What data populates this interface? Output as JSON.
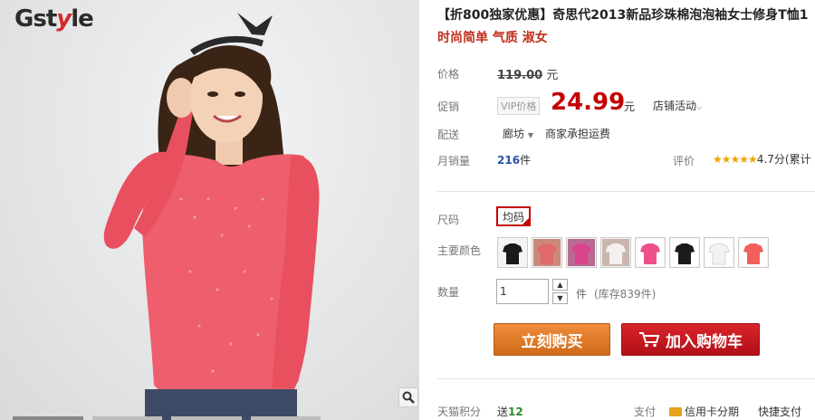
{
  "gallery": {
    "brand_prefix": "Gst",
    "brand_y": "y",
    "brand_suffix": "le"
  },
  "product": {
    "title": "【折800独家优惠】奇思代2013新品珍珠棉泡泡袖女士修身T恤1",
    "subtitle": "时尚简单 气质 淑女"
  },
  "price": {
    "label": "价格",
    "original": "119.00",
    "unit": "元"
  },
  "promo": {
    "label": "促销",
    "vip_tag": "VIP价格",
    "price": "24.99",
    "unit": "元",
    "shop_event": "店铺活动"
  },
  "shipping": {
    "label": "配送",
    "city": "廊坊",
    "note": "商家承担运费"
  },
  "sales": {
    "label": "月销量",
    "count": "216",
    "unit": "件"
  },
  "rating": {
    "label": "评价",
    "stars": "★★★★★",
    "text": "4.7分(累计"
  },
  "size": {
    "label": "尺码",
    "selected": "均码"
  },
  "color": {
    "label": "主要颜色",
    "swatches": [
      "#1a1a1a",
      "#e06a6a",
      "#d9448c",
      "#f4f0ee",
      "#ef4f8a",
      "#1b1b1b",
      "#fafafa",
      "#f2605e"
    ]
  },
  "quantity": {
    "label": "数量",
    "value": "1",
    "unit": "件",
    "stock": "(库存839件)"
  },
  "actions": {
    "buy_now": "立刻购买",
    "add_to_cart": "加入购物车"
  },
  "footer": {
    "points_label": "天猫积分",
    "points_prefix": "送",
    "points_value": "12",
    "pay_label": "支付",
    "card_pay": "信用卡分期",
    "quick_pay": "快捷支付"
  },
  "colors": {
    "accent_red": "#c40000",
    "buy_orange": "#e07a26",
    "cart_red": "#c81a22"
  }
}
